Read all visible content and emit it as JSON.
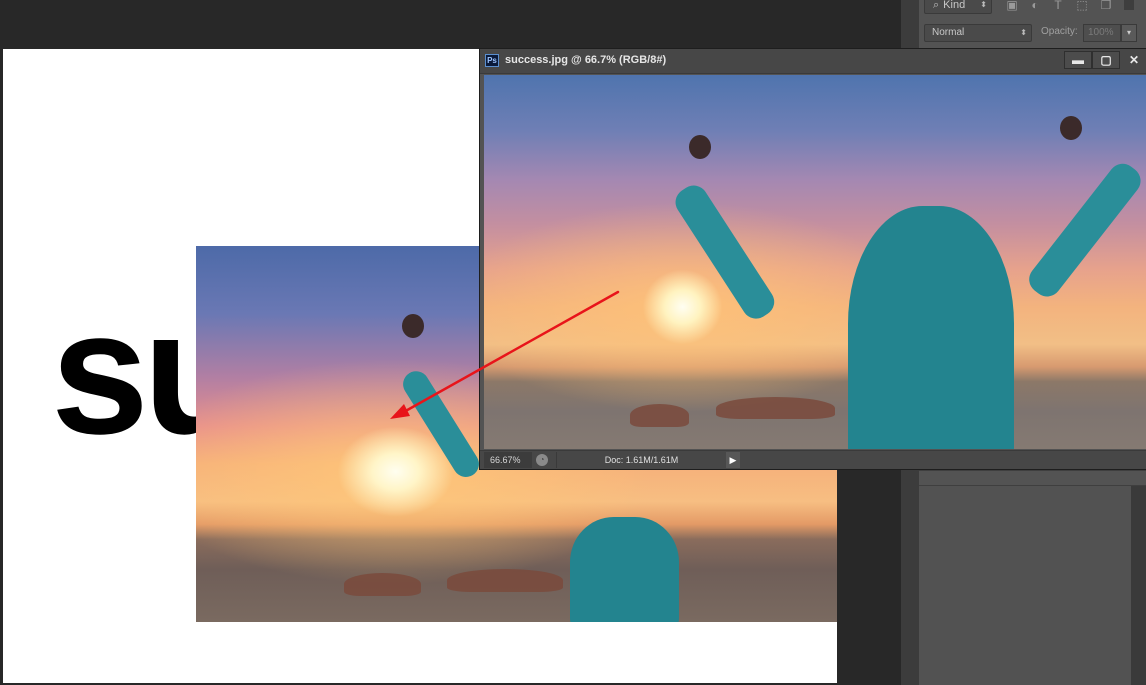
{
  "background_document": {
    "headline_fragment": "su"
  },
  "layers_panel": {
    "kind_filter": {
      "label": "Kind",
      "icon": "search-icon"
    },
    "filter_icons": [
      "image-filter-icon",
      "adjustment-filter-icon",
      "type-filter-icon",
      "shape-filter-icon",
      "smart-object-filter-icon"
    ],
    "filter_glyphs": [
      "▣",
      "◐",
      "T",
      "⬚",
      "❐"
    ],
    "blend_mode": "Normal",
    "opacity_label": "Opacity:",
    "opacity_value": "100%"
  },
  "document_window": {
    "title": "success.jpg @ 66.7% (RGB/8#)",
    "app_icon_label": "Ps",
    "buttons": {
      "minimize": "▬",
      "maximize": "▢",
      "close": "✕"
    },
    "status": {
      "zoom": "66.67%",
      "doc_info": "Doc: 1.61M/1.61M",
      "menu_arrow": "▶"
    }
  },
  "colors": {
    "workspace_bg": "#282828",
    "panel_bg": "#535353",
    "annotation_arrow": "#e8141a"
  }
}
